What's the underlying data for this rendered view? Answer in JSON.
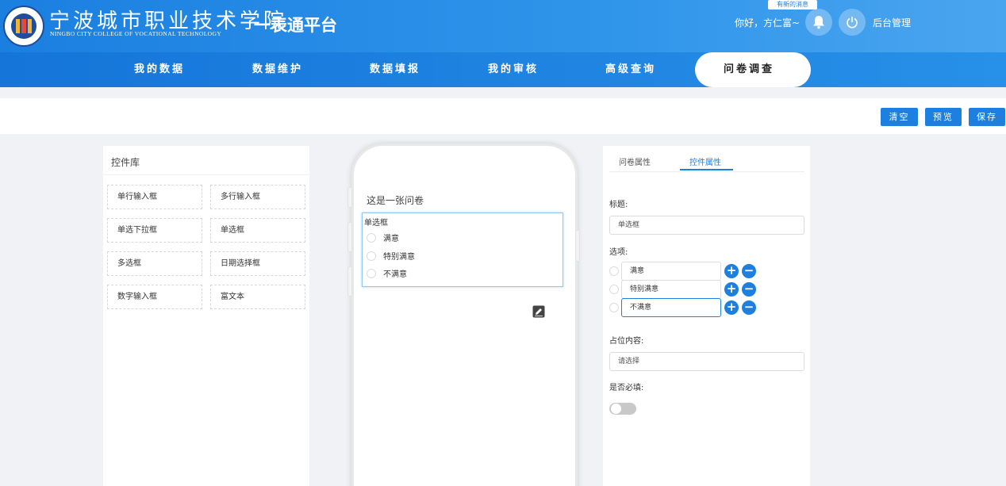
{
  "header": {
    "school_cn": "宁波城市职业技术学院",
    "school_en": "NINGBO CITY COLLEGE OF VOCATIONAL TECHNOLOGY",
    "platform": "一表通平台",
    "msg_badge": "有新的消息",
    "greeting": "你好，方仁富~",
    "admin_label": "后台管理"
  },
  "nav": {
    "items": [
      {
        "label": "我的数据"
      },
      {
        "label": "数据维护"
      },
      {
        "label": "数据填报"
      },
      {
        "label": "我的审核"
      },
      {
        "label": "高级查询"
      },
      {
        "label": "问卷调查"
      }
    ]
  },
  "toolbar": {
    "clear_label": "清空",
    "preview_label": "预览",
    "save_label": "保存"
  },
  "library": {
    "title": "控件库",
    "items": [
      {
        "label": "单行输入框"
      },
      {
        "label": "多行输入框"
      },
      {
        "label": "单选下拉框"
      },
      {
        "label": "单选框"
      },
      {
        "label": "多选框"
      },
      {
        "label": "日期选择框"
      },
      {
        "label": "数字输入框"
      },
      {
        "label": "富文本"
      }
    ]
  },
  "survey": {
    "title": "这是一张问卷",
    "question_label": "单选框",
    "options": [
      "满意",
      "特别满意",
      "不满意"
    ]
  },
  "props": {
    "tabs": [
      {
        "label": "问卷属性"
      },
      {
        "label": "控件属性"
      }
    ],
    "title_label": "标题:",
    "title_value": "单选框",
    "options_label": "选项:",
    "options": [
      "满意",
      "特别满意",
      "不满意"
    ],
    "placeholder_label": "占位内容:",
    "placeholder_value": "请选择",
    "required_label": "是否必填:"
  },
  "colors": {
    "primary": "#1d7fe0",
    "header_start": "#1b7fe0",
    "header_end": "#4aa5ef"
  }
}
